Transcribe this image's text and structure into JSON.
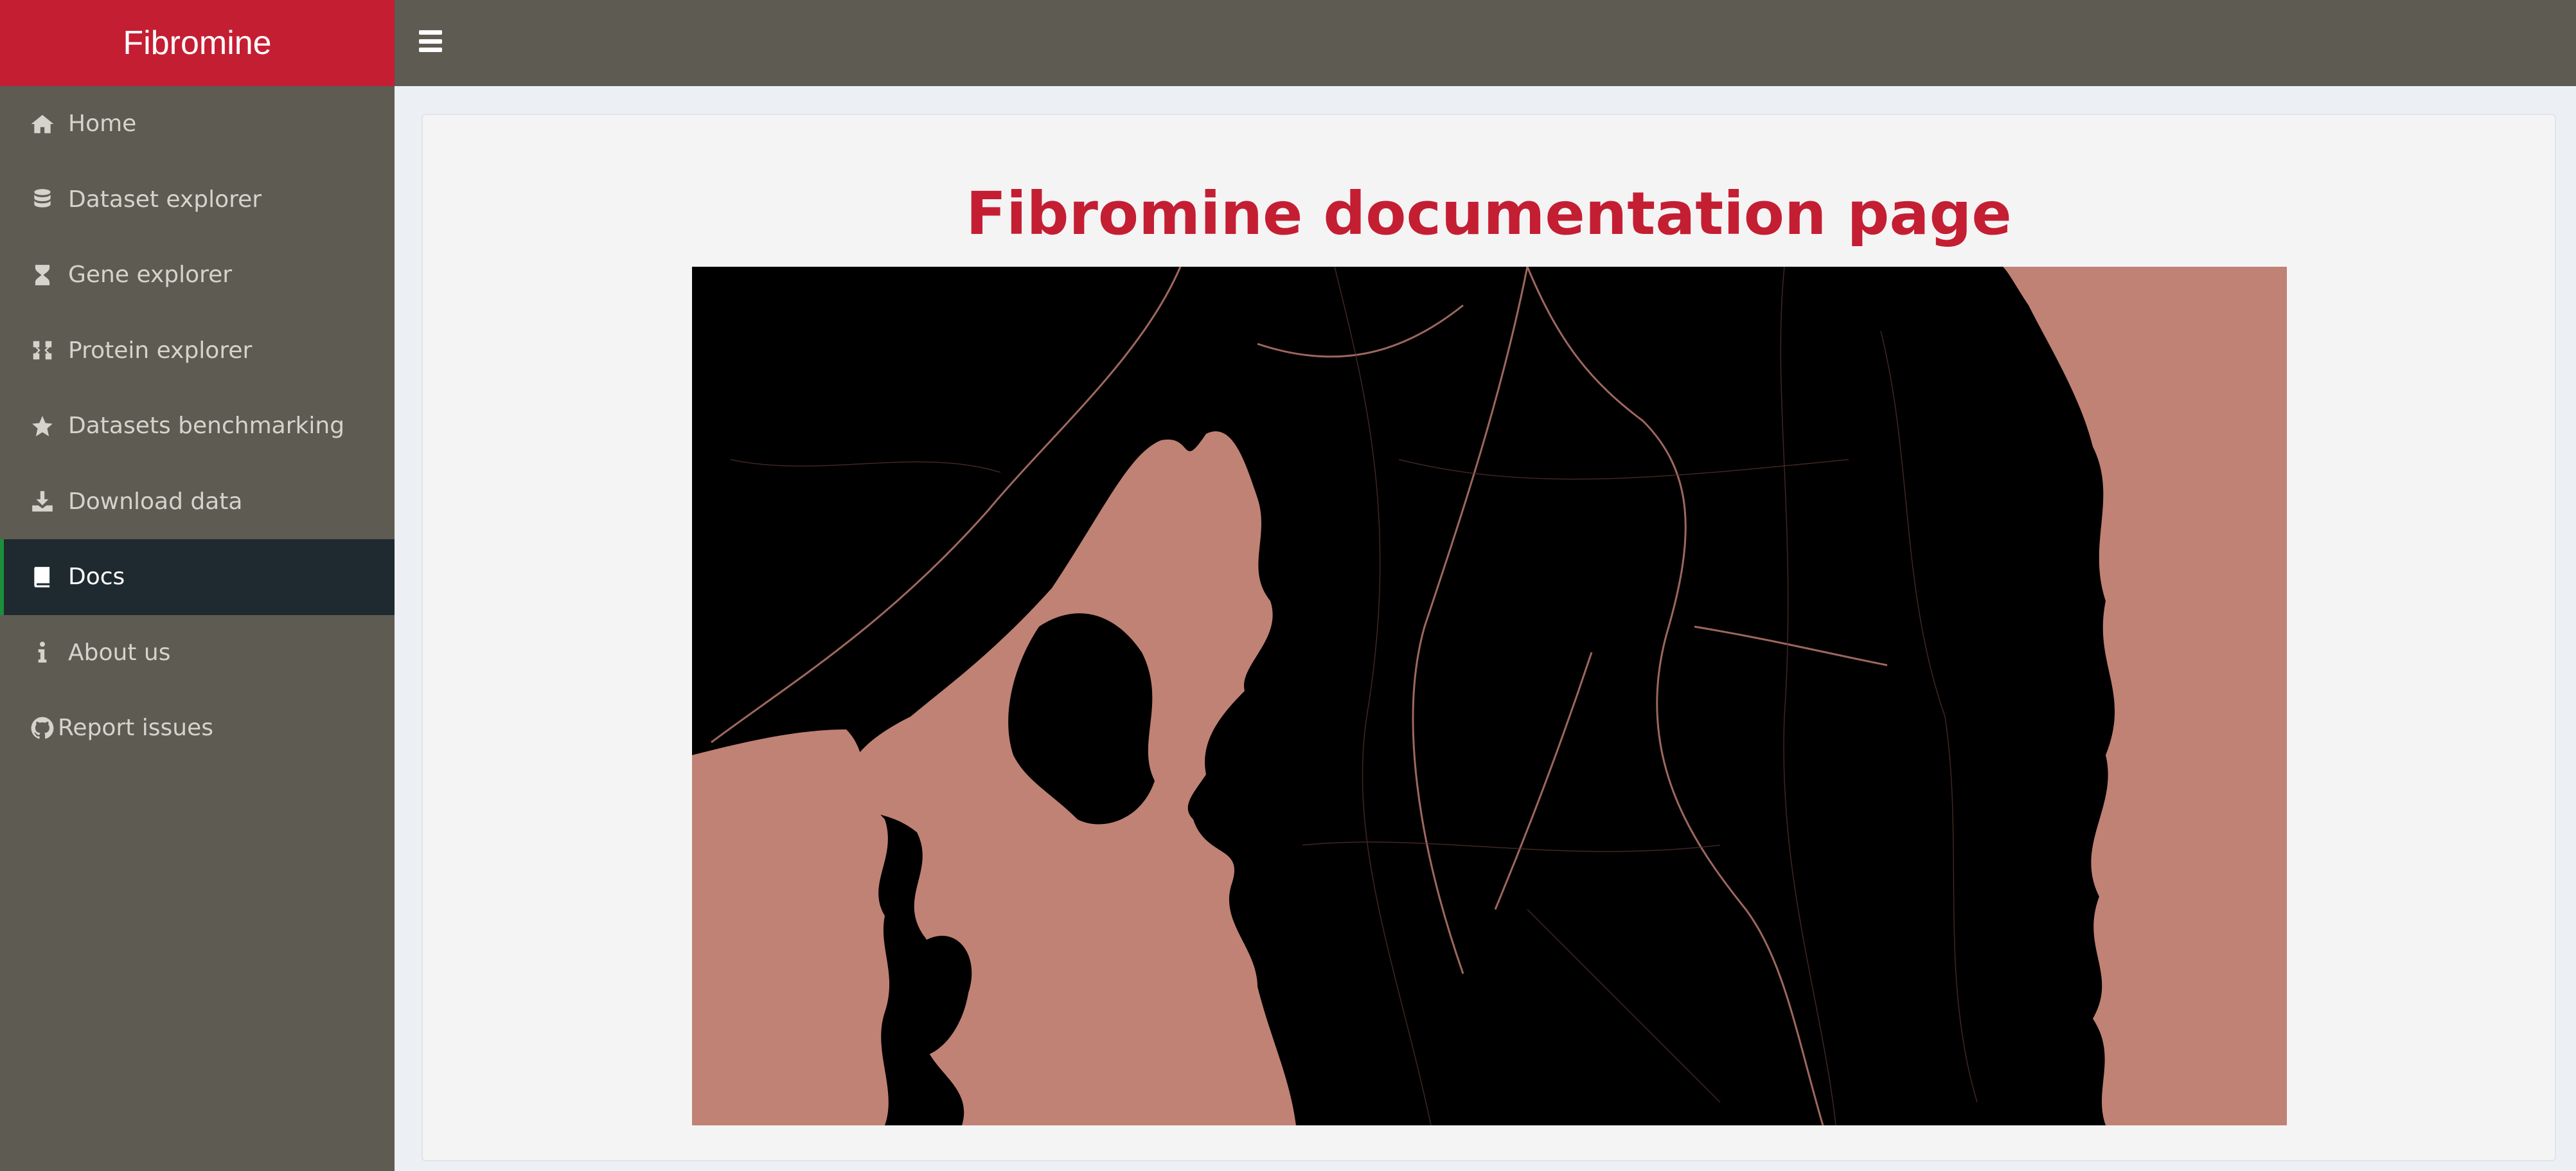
{
  "brand": {
    "title": "Fibromine"
  },
  "sidebar": {
    "items": [
      {
        "label": "Home",
        "icon": "home-icon"
      },
      {
        "label": "Dataset explorer",
        "icon": "database-icon"
      },
      {
        "label": "Gene explorer",
        "icon": "dna-icon"
      },
      {
        "label": "Protein explorer",
        "icon": "network-icon"
      },
      {
        "label": "Datasets benchmarking",
        "icon": "star-icon"
      },
      {
        "label": "Download data",
        "icon": "download-icon"
      },
      {
        "label": "Docs",
        "icon": "book-icon",
        "active": true
      },
      {
        "label": "About us",
        "icon": "info-icon"
      },
      {
        "label": "Report issues",
        "icon": "github-icon"
      }
    ]
  },
  "navbar": {
    "menu_icon": "hamburger-icon"
  },
  "main": {
    "title": "Fibromine documentation page",
    "image": "city-map-image"
  },
  "colors": {
    "brand": "#c41e33",
    "sidebar": "#5e5b52",
    "active_item": "#1f2a30",
    "active_border": "#1a8f3c",
    "map_water": "#c08275",
    "map_land": "#000000"
  }
}
